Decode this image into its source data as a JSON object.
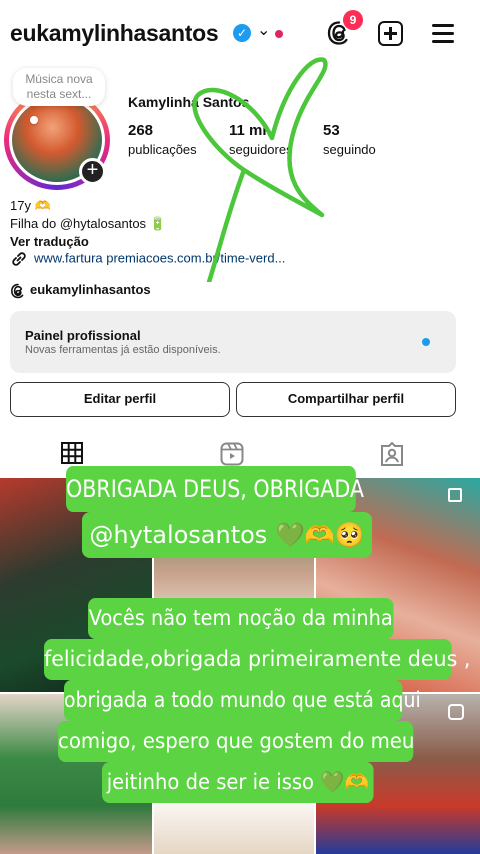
{
  "header": {
    "username": "eukamylinhasantos",
    "notification_count": "9"
  },
  "profile": {
    "note": "Música nova nesta sext...",
    "display_name": "Kamylinha Santos",
    "stats": [
      {
        "value": "268",
        "label": "publicações"
      },
      {
        "value": "11 mi",
        "label": "seguidores"
      },
      {
        "value": "53",
        "label": "seguindo"
      }
    ],
    "bio_line1": "17y 🫶",
    "bio_line2": "Filha do @hytalosantos 🔋",
    "translate": "Ver tradução",
    "link": "www.fartura premiacoes.com.br/time-verd...",
    "threads_handle": "eukamylinhasantos"
  },
  "panel": {
    "title": "Painel profissional",
    "subtitle": "Novas ferramentas já estão disponíveis."
  },
  "buttons": {
    "edit": "Editar perfil",
    "share": "Compartilhar perfil"
  },
  "story_text": {
    "line1": "OBRIGADA DEUS, OBRIGADA",
    "line2": "@hytalosantos 💚🫶🥺",
    "paragraph": [
      "Vocês não tem noção da minha",
      "felicidade,obrigada primeiramente deus ,",
      "obrigada a todo mundo que está aqui",
      "comigo, espero que gostem do meu",
      "jeitinho de ser ie isso 💚🫶"
    ]
  },
  "colors": {
    "caption_green": "#5bd342",
    "heart_green": "#4cc63a",
    "verified_blue": "#1d9bf0",
    "badge_red": "#ff2d55"
  }
}
